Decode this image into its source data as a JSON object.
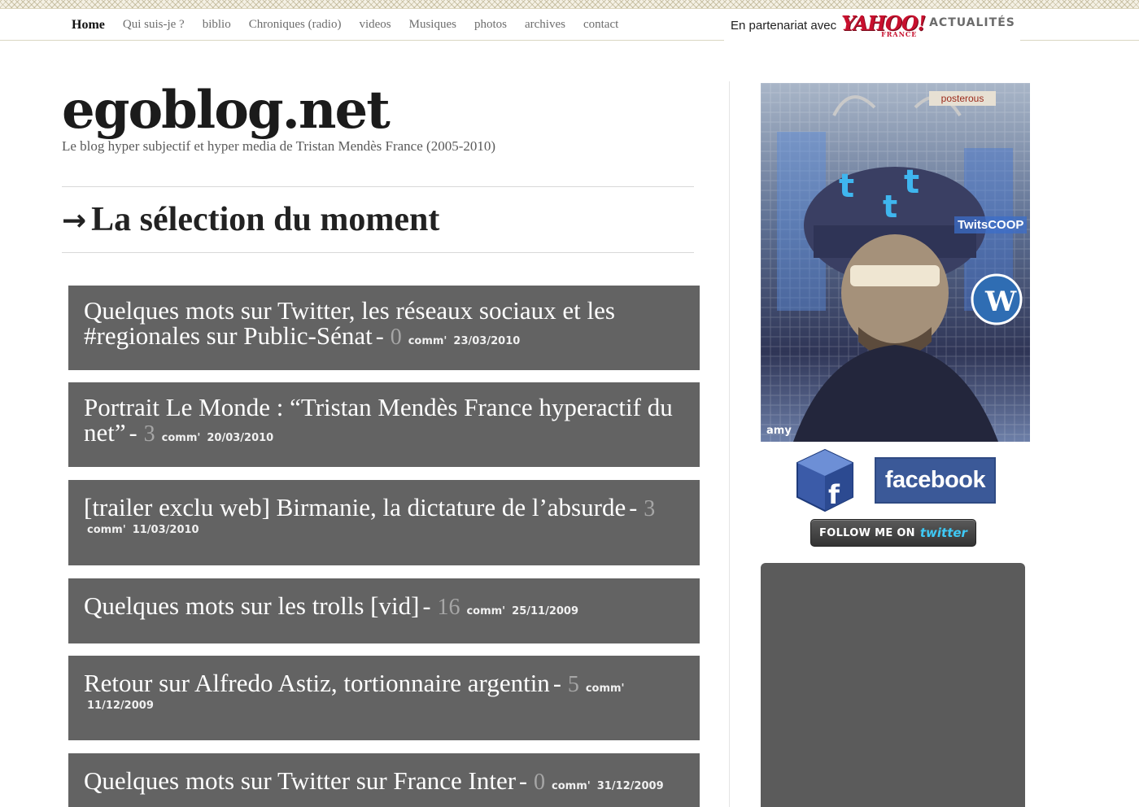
{
  "nav": {
    "items": [
      {
        "label": "Home",
        "active": true
      },
      {
        "label": "Qui suis-je ?"
      },
      {
        "label": "biblio"
      },
      {
        "label": "Chroniques (radio)"
      },
      {
        "label": "videos"
      },
      {
        "label": "Musiques"
      },
      {
        "label": "photos"
      },
      {
        "label": "archives"
      },
      {
        "label": "contact"
      }
    ]
  },
  "partner": {
    "text": "En partenariat avec",
    "logo_word": "YAHOO!",
    "logo_sub": "FRANCE",
    "section": "ACTUALITÉS"
  },
  "header": {
    "title": "egoblog.net",
    "tagline": "Le blog hyper subjectif et hyper media de Tristan Mendès France (2005-2010)"
  },
  "section": {
    "arrow": "→",
    "heading": "La sélection du moment"
  },
  "posts": [
    {
      "title": "Quelques mots sur Twitter, les réseaux sociaux et les #regionales sur Public-Sénat",
      "sep": "-",
      "count": "0",
      "comm": "comm'",
      "date": "23/03/2010"
    },
    {
      "title": "Portrait Le Monde : “Tristan Mendès France hyperactif du net”",
      "sep": "-",
      "count": "3",
      "comm": "comm'",
      "date": "20/03/2010"
    },
    {
      "title": "[trailer exclu web] Birmanie, la dictature de l’absurde",
      "sep": "-",
      "count": "3",
      "comm": "comm'",
      "date": "11/03/2010"
    },
    {
      "title": "Quelques mots sur les trolls [vid]",
      "sep": "-",
      "count": "16",
      "comm": "comm'",
      "date": "25/11/2009"
    },
    {
      "title": "Retour sur Alfredo Astiz, tortionnaire argentin",
      "sep": "-",
      "count": "5",
      "comm": "comm'",
      "date": "11/12/2009"
    },
    {
      "title": "Quelques mots sur Twitter sur France Inter",
      "sep": "-",
      "count": "0",
      "comm": "comm'",
      "date": "31/12/2009"
    }
  ],
  "sidebar": {
    "portrait_badge": "posterous",
    "portrait_sign": "amy",
    "portrait_tag": "TwitsCOOP",
    "facebook_label": "facebook",
    "twitter_text": "FOLLOW ME ON",
    "twitter_logo": "twitter"
  }
}
